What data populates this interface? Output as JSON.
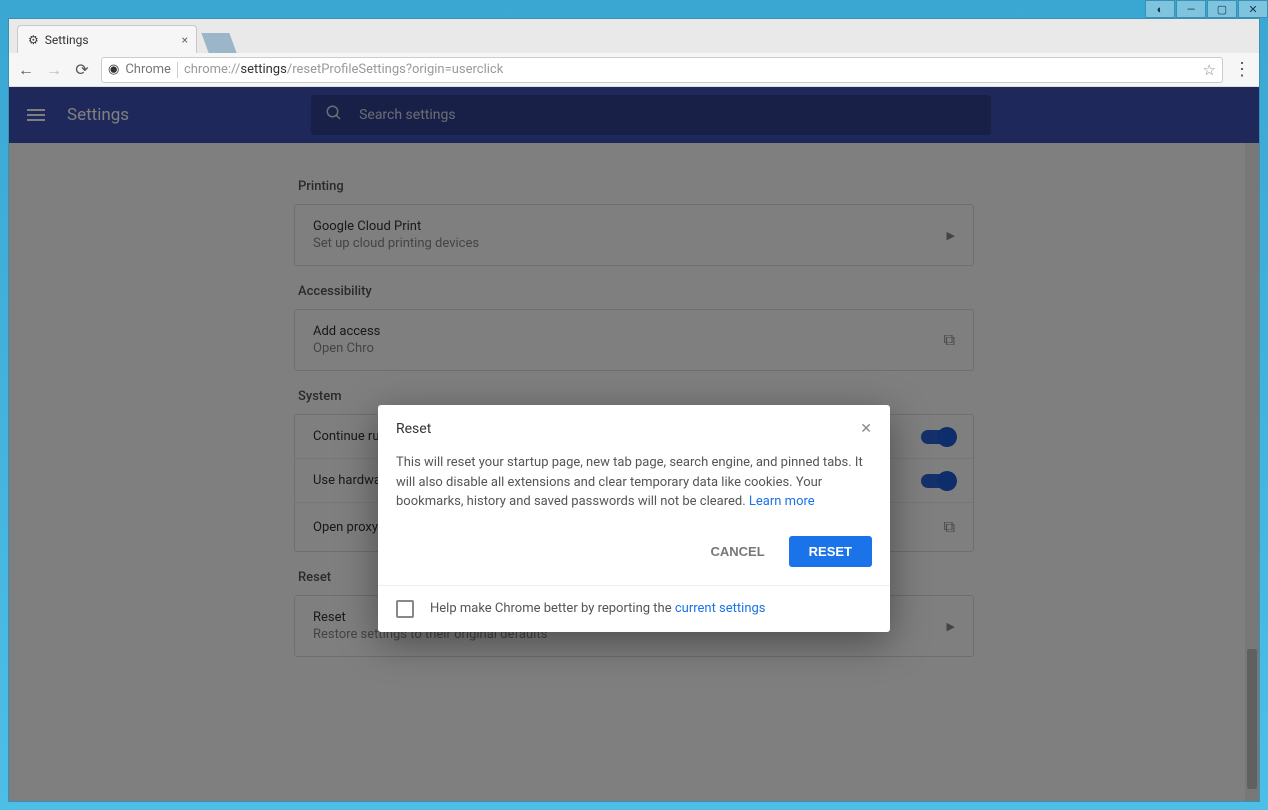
{
  "tab": {
    "title": "Settings"
  },
  "address": {
    "scheme": "Chrome",
    "url_prefix": "chrome://",
    "url_bold": "settings",
    "url_rest": "/resetProfileSettings?origin=userclick"
  },
  "appbar": {
    "title": "Settings",
    "search_placeholder": "Search settings"
  },
  "sections": {
    "printing": {
      "heading": "Printing",
      "item_title": "Google Cloud Print",
      "item_sub": "Set up cloud printing devices"
    },
    "accessibility": {
      "heading": "Accessibility",
      "item_title": "Add access",
      "item_sub": "Open Chro"
    },
    "system": {
      "heading": "System",
      "row1": "Continue ru",
      "row2": "Use hardwa",
      "row3": "Open proxy"
    },
    "reset": {
      "heading": "Reset",
      "item_title": "Reset",
      "item_sub": "Restore settings to their original defaults"
    }
  },
  "dialog": {
    "title": "Reset",
    "body_text": "This will reset your startup page, new tab page, search engine, and pinned tabs. It will also disable all extensions and clear temporary data like cookies. Your bookmarks, history and saved passwords will not be cleared. ",
    "learn_more": "Learn more",
    "cancel": "CANCEL",
    "confirm": "RESET",
    "help_text_pre": "Help make Chrome better by reporting the ",
    "help_link": "current settings"
  }
}
